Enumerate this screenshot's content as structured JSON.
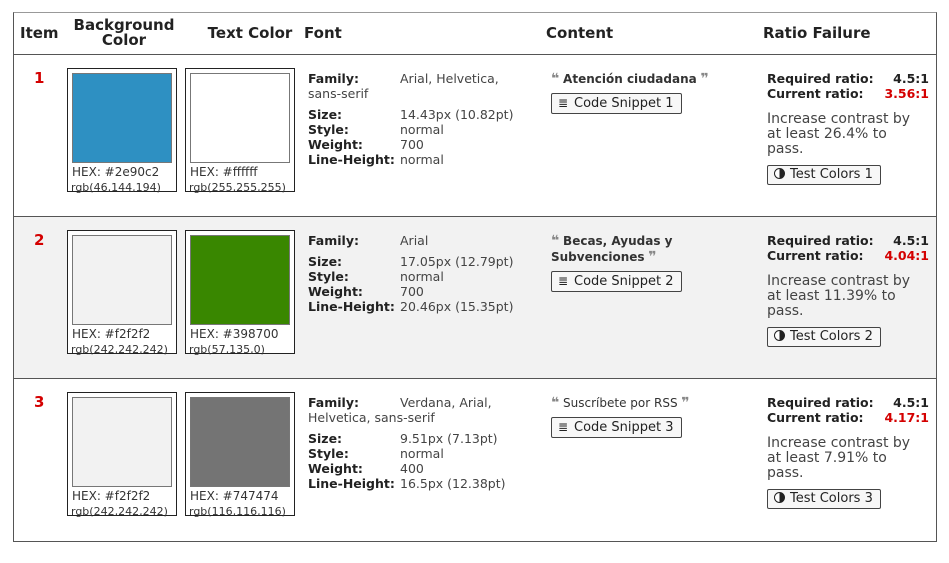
{
  "headers": {
    "item": "Item",
    "background_color": "Background Color",
    "text_color": "Text Color",
    "font": "Font",
    "content": "Content",
    "ratio_failure": "Ratio Failure"
  },
  "font_labels": {
    "family": "Family:",
    "size": "Size:",
    "style": "Style:",
    "weight": "Weight:",
    "line_height": "Line-Height:"
  },
  "ratio_labels": {
    "required": "Required ratio:",
    "current": "Current ratio:"
  },
  "rows": [
    {
      "item": "1",
      "bg": {
        "hex_label": "HEX: #2e90c2",
        "rgb_label": "rgb(46,144,194)",
        "color": "#2e90c2"
      },
      "text": {
        "hex_label": "HEX: #ffffff",
        "rgb_label": "rgb(255,255,255)",
        "color": "#ffffff"
      },
      "font": {
        "family_first": "Arial, Helvetica,",
        "family_rest": "sans-serif",
        "size": "14.43px (10.82pt)",
        "style": "normal",
        "weight": "700",
        "line_height": "normal"
      },
      "content": {
        "text": "Atención ciudadana",
        "snippet_button": "Code Snippet 1",
        "bold": true
      },
      "ratio": {
        "required": "4.5:1",
        "current": "3.56:1",
        "advice": "Increase contrast by at least 26.4% to pass.",
        "test_button": "Test Colors 1"
      }
    },
    {
      "item": "2",
      "bg": {
        "hex_label": "HEX: #f2f2f2",
        "rgb_label": "rgb(242,242,242)",
        "color": "#f2f2f2"
      },
      "text": {
        "hex_label": "HEX: #398700",
        "rgb_label": "rgb(57,135,0)",
        "color": "#398700"
      },
      "font": {
        "family_first": "Arial",
        "family_rest": "",
        "size": "17.05px (12.79pt)",
        "style": "normal",
        "weight": "700",
        "line_height": "20.46px (15.35pt)"
      },
      "content": {
        "text": "Becas, Ayudas y Subvenciones",
        "snippet_button": "Code Snippet 2",
        "bold": true
      },
      "ratio": {
        "required": "4.5:1",
        "current": "4.04:1",
        "advice": "Increase contrast by at least 11.39% to pass.",
        "test_button": "Test Colors 2"
      }
    },
    {
      "item": "3",
      "bg": {
        "hex_label": "HEX: #f2f2f2",
        "rgb_label": "rgb(242,242,242)",
        "color": "#f2f2f2"
      },
      "text": {
        "hex_label": "HEX: #747474",
        "rgb_label": "rgb(116,116,116)",
        "color": "#747474"
      },
      "font": {
        "family_first": "Verdana, Arial,",
        "family_rest": "Helvetica, sans-serif",
        "size": "9.51px (7.13pt)",
        "style": "normal",
        "weight": "400",
        "line_height": "16.5px (12.38pt)"
      },
      "content": {
        "text": "Suscríbete por RSS",
        "snippet_button": "Code Snippet 3",
        "bold": false
      },
      "ratio": {
        "required": "4.5:1",
        "current": "4.17:1",
        "advice": "Increase contrast by at least 7.91% to pass.",
        "test_button": "Test Colors 3"
      }
    }
  ],
  "icons": {
    "quote_open": "❝",
    "quote_close": "❞",
    "snippet_icon": "≣"
  }
}
